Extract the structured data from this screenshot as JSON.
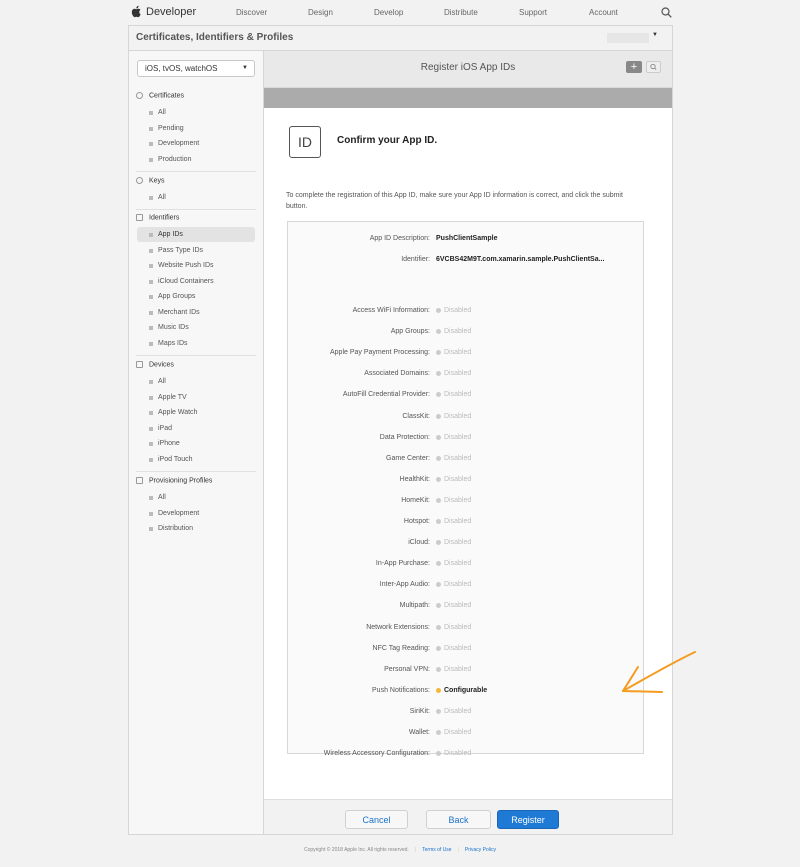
{
  "nav": {
    "brand": "Developer",
    "links": [
      "Discover",
      "Design",
      "Develop",
      "Distribute",
      "Support",
      "Account"
    ]
  },
  "header": {
    "title": "Certificates, Identifiers & Profiles"
  },
  "sidebar": {
    "platform": "iOS, tvOS, watchOS",
    "sections": [
      {
        "title": "Certificates",
        "items": [
          "All",
          "Pending",
          "Development",
          "Production"
        ]
      },
      {
        "title": "Keys",
        "items": [
          "All"
        ]
      },
      {
        "title": "Identifiers",
        "items": [
          "App IDs",
          "Pass Type IDs",
          "Website Push IDs",
          "iCloud Containers",
          "App Groups",
          "Merchant IDs",
          "Music IDs",
          "Maps IDs"
        ]
      },
      {
        "title": "Devices",
        "items": [
          "All",
          "Apple TV",
          "Apple Watch",
          "iPad",
          "iPhone",
          "iPod Touch"
        ]
      },
      {
        "title": "Provisioning Profiles",
        "items": [
          "All",
          "Development",
          "Distribution"
        ]
      }
    ]
  },
  "content": {
    "title": "Register iOS App IDs",
    "add_label": "+",
    "id_badge": "ID",
    "confirm_title": "Confirm your App ID.",
    "instructions": "To complete the registration of this App ID, make sure your App ID information is correct, and click the submit button."
  },
  "app_id": {
    "description_label": "App ID Description:",
    "description": "PushClientSample",
    "identifier_label": "Identifier:",
    "identifier": "6VCBS42M9T.com.xamarin.sample.PushClientSa..."
  },
  "capabilities": [
    {
      "label": "Access WiFi Information:",
      "status": "Disabled"
    },
    {
      "label": "App Groups:",
      "status": "Disabled"
    },
    {
      "label": "Apple Pay Payment Processing:",
      "status": "Disabled"
    },
    {
      "label": "Associated Domains:",
      "status": "Disabled"
    },
    {
      "label": "AutoFill Credential Provider:",
      "status": "Disabled"
    },
    {
      "label": "ClassKit:",
      "status": "Disabled"
    },
    {
      "label": "Data Protection:",
      "status": "Disabled"
    },
    {
      "label": "Game Center:",
      "status": "Disabled"
    },
    {
      "label": "HealthKit:",
      "status": "Disabled"
    },
    {
      "label": "HomeKit:",
      "status": "Disabled"
    },
    {
      "label": "Hotspot:",
      "status": "Disabled"
    },
    {
      "label": "iCloud:",
      "status": "Disabled"
    },
    {
      "label": "In-App Purchase:",
      "status": "Disabled"
    },
    {
      "label": "Inter-App Audio:",
      "status": "Disabled"
    },
    {
      "label": "Multipath:",
      "status": "Disabled"
    },
    {
      "label": "Network Extensions:",
      "status": "Disabled"
    },
    {
      "label": "NFC Tag Reading:",
      "status": "Disabled"
    },
    {
      "label": "Personal VPN:",
      "status": "Disabled"
    },
    {
      "label": "Push Notifications:",
      "status": "Configurable"
    },
    {
      "label": "SiriKit:",
      "status": "Disabled"
    },
    {
      "label": "Wallet:",
      "status": "Disabled"
    },
    {
      "label": "Wireless Accessory Configuration:",
      "status": "Disabled"
    }
  ],
  "buttons": {
    "cancel": "Cancel",
    "back": "Back",
    "register": "Register"
  },
  "footer": {
    "copyright": "Copyright © 2018 Apple Inc. All rights reserved.",
    "terms": "Terms of Use",
    "privacy": "Privacy Policy"
  },
  "colors": {
    "accent": "#1f7ad6",
    "configurable": "#f5b73a",
    "annotation_arrow": "#f39c1f"
  }
}
